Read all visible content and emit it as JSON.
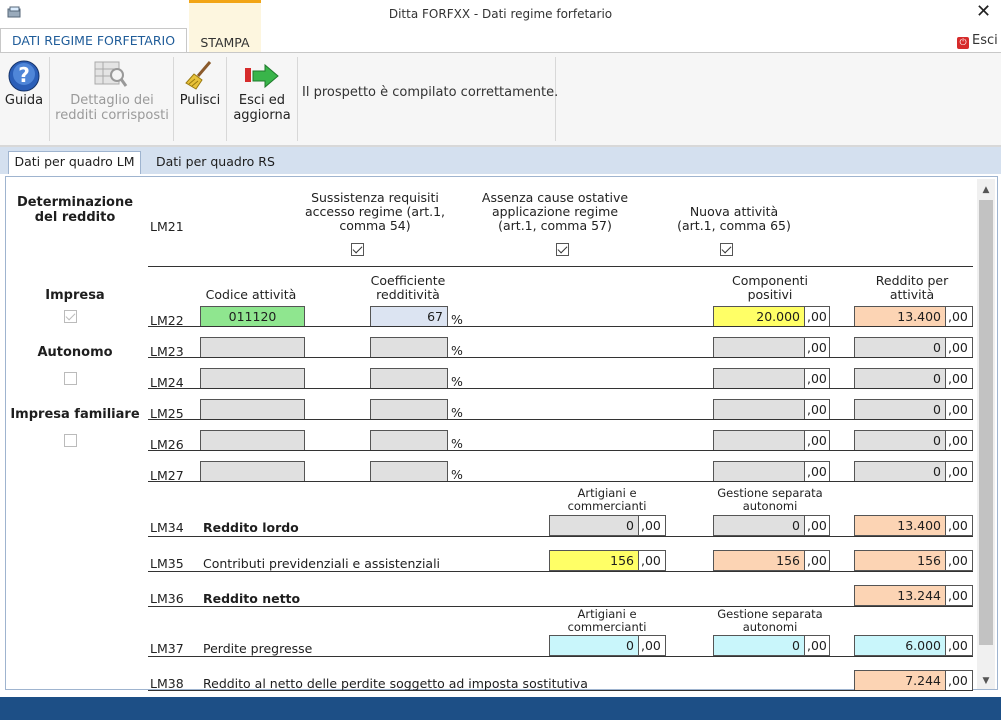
{
  "window": {
    "title": "Ditta FORFXX - Dati regime forfetario",
    "close_glyph": "✕"
  },
  "menu_tabs": {
    "dati": "DATI REGIME FORFETARIO",
    "stampa": "STAMPA",
    "esci": "Esci"
  },
  "ribbon": {
    "guida": "Guida",
    "dettaglio": "Dettaglio dei redditi corrisposti",
    "pulisci": "Pulisci",
    "esci_aggiorna": "Esci ed aggiorna",
    "message": "Il prospetto è compilato correttamente."
  },
  "inner_tabs": {
    "lm": "Dati per quadro LM",
    "rs": "Dati per quadro RS"
  },
  "left": {
    "determinazione": "Determinazione del reddito",
    "impresa": "Impresa",
    "autonomo": "Autonomo",
    "impresa_familiare": "Impresa familiare"
  },
  "lm21": {
    "code": "LM21",
    "h1": "Sussistenza requisiti accesso regime (art.1, comma 54)",
    "h2": "Assenza cause ostative applicazione regime (art.1, comma 57)",
    "h3": "Nuova attività (art.1, comma 65)"
  },
  "headers": {
    "codice": "Codice attività",
    "coefficiente": "Coefficiente redditività",
    "componenti": "Componenti positivi",
    "reddito_att": "Reddito per attività",
    "artigiani": "Artigiani e commercianti",
    "gestione": "Gestione separata autonomi"
  },
  "pct": "%",
  "dec": ",00",
  "rows": [
    {
      "code": "LM22",
      "codice": "011120",
      "coeff": "67",
      "comp": "20.000",
      "redd": "13.400"
    },
    {
      "code": "LM23",
      "codice": "",
      "coeff": "",
      "comp": "",
      "redd": "0"
    },
    {
      "code": "LM24",
      "codice": "",
      "coeff": "",
      "comp": "",
      "redd": "0"
    },
    {
      "code": "LM25",
      "codice": "",
      "coeff": "",
      "comp": "",
      "redd": "0"
    },
    {
      "code": "LM26",
      "codice": "",
      "coeff": "",
      "comp": "",
      "redd": "0"
    },
    {
      "code": "LM27",
      "codice": "",
      "coeff": "",
      "comp": "",
      "redd": "0"
    }
  ],
  "lm34": {
    "code": "LM34",
    "label": "Reddito lordo",
    "art": "0",
    "gest": "0",
    "tot": "13.400"
  },
  "lm35": {
    "code": "LM35",
    "label": "Contributi previdenziali e assistenziali",
    "art": "156",
    "gest": "156",
    "tot": "156"
  },
  "lm36": {
    "code": "LM36",
    "label": "Reddito netto",
    "tot": "13.244"
  },
  "lm37": {
    "code": "LM37",
    "label": "Perdite pregresse",
    "art": "0",
    "gest": "0",
    "tot": "6.000"
  },
  "lm38": {
    "code": "LM38",
    "label": "Reddito al netto delle perdite soggetto ad imposta sostitutiva",
    "tot": "7.244"
  }
}
